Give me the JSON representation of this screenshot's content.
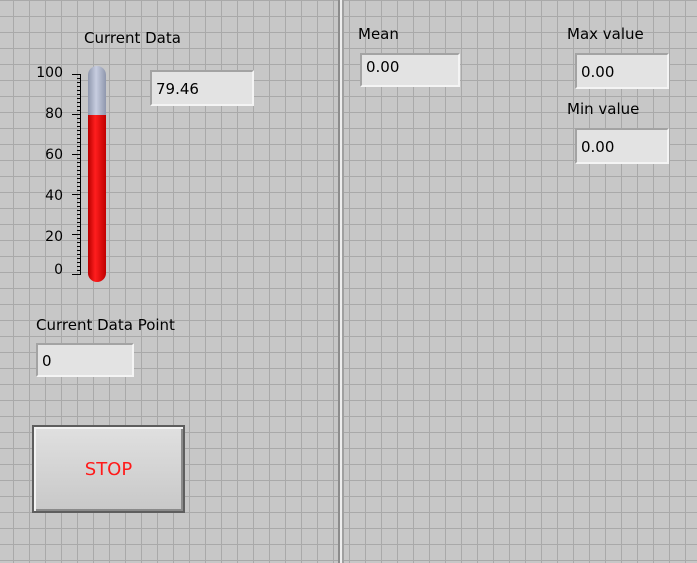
{
  "left_panel": {
    "thermometer": {
      "label": "Current Data",
      "value_text": "79.46",
      "level": 79.46,
      "scale": [
        "100",
        "80",
        "60",
        "40",
        "20",
        "0"
      ],
      "scale_max": 100,
      "fill_color": "#ff1e1e",
      "empty_color": "#c7cde0"
    },
    "current_data_point": {
      "label": "Current Data Point",
      "value": "0"
    },
    "stop_button": {
      "label": "STOP",
      "text_color": "#ff1a1a"
    }
  },
  "right_panel": {
    "mean": {
      "label": "Mean",
      "value": "0.00"
    },
    "max_value": {
      "label": "Max value",
      "value": "0.00"
    },
    "min_value": {
      "label": "Min value",
      "value": "0.00"
    }
  },
  "colors": {
    "panel_bg": "#c7c7c7",
    "grid_lines": "#a9a9a9",
    "indicator_bg": "#e3e3e3"
  }
}
